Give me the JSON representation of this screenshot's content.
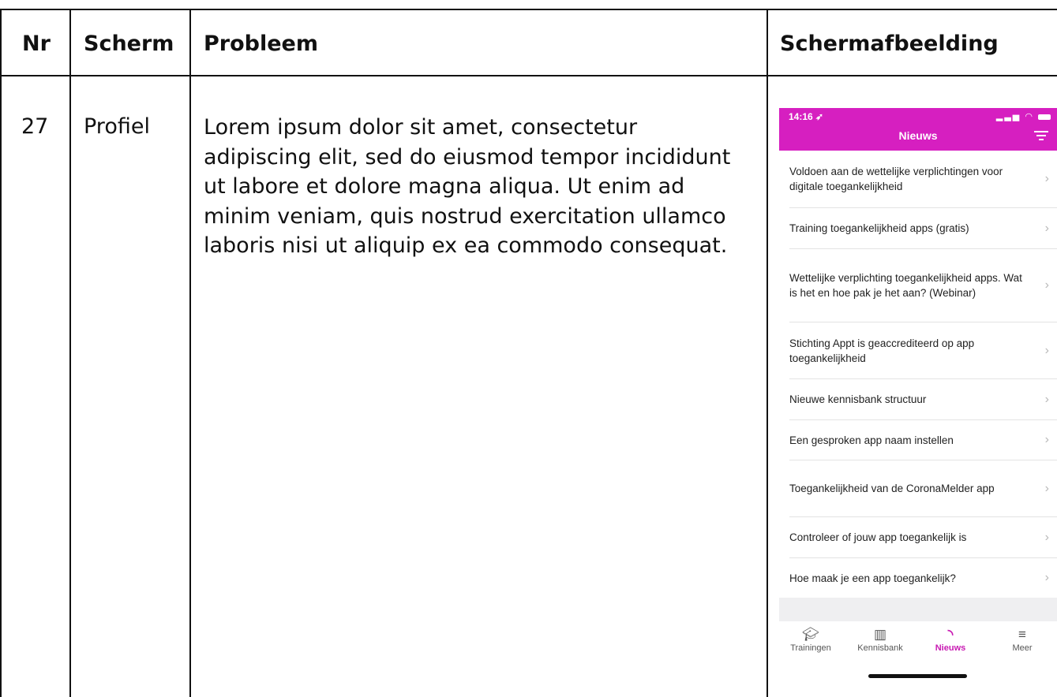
{
  "table": {
    "headers": [
      "Nr",
      "Scherm",
      "Probleem",
      "Schermafbeelding"
    ],
    "row": {
      "nr": "27",
      "scherm": "Profiel",
      "probleem": "Lorem ipsum dolor sit amet, consectetur adipiscing elit, sed do eiusmod tempor incididunt ut labore et dolore magna aliqua. Ut enim ad minim veniam, quis nostrud exercitation ullamco laboris nisi ut aliquip ex ea commodo consequat."
    }
  },
  "phone": {
    "time": "14:16",
    "title": "Nieuws",
    "accent": "#d61fc0",
    "items": [
      "Voldoen aan de wettelijke verplichtingen voor digitale toegankelijkheid",
      "Training toegankelijkheid apps (gratis)",
      "Wettelijke verplichting toegankelijkheid apps. Wat is het en hoe pak je het aan? (Webinar)",
      "Stichting Appt is geaccrediteerd op app toegankelijkheid",
      "Nieuwe kennisbank structuur",
      "Een gesproken app naam instellen",
      "Toegankelijkheid van de CoronaMelder app",
      "Controleer of jouw app toegankelijk is",
      "Hoe maak je een app toegankelijk?"
    ],
    "tabs": [
      {
        "label": "Trainingen",
        "icon": "graduation-cap-icon"
      },
      {
        "label": "Kennisbank",
        "icon": "book-icon"
      },
      {
        "label": "Nieuws",
        "icon": "rss-icon"
      },
      {
        "label": "Meer",
        "icon": "menu-icon"
      }
    ]
  }
}
